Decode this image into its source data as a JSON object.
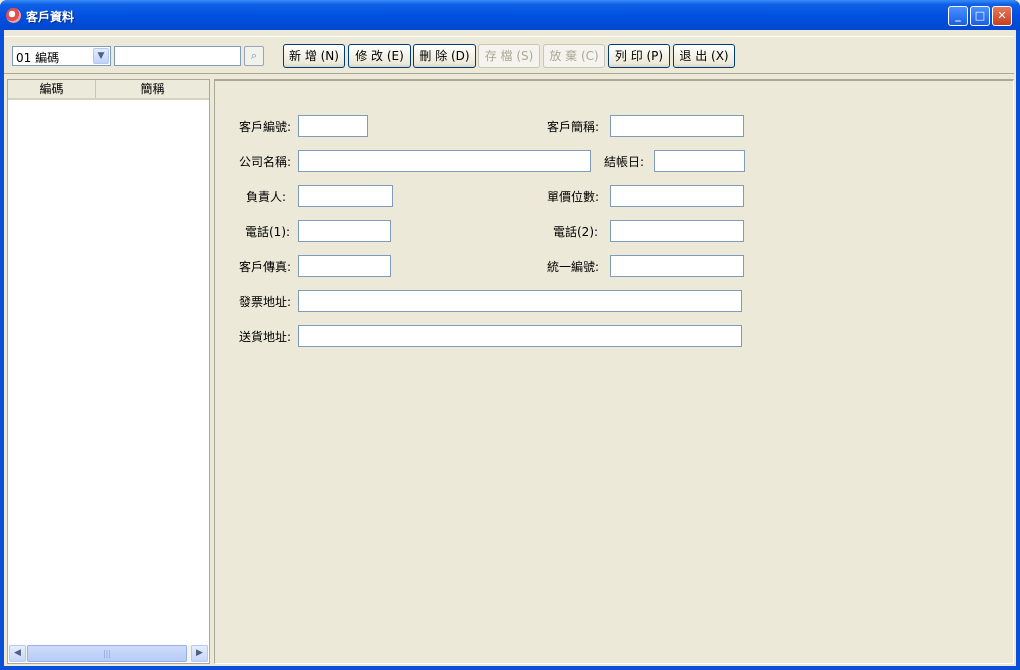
{
  "window": {
    "title": "客戶資料",
    "controls": {
      "minimize": "_",
      "maximize": "□",
      "close": "✕"
    }
  },
  "toolbar": {
    "field_select": {
      "selected": "01 編碼"
    },
    "search": {
      "value": ""
    },
    "buttons": {
      "add": "新 增 (N)",
      "edit": "修 改 (E)",
      "delete": "刪 除 (D)",
      "save": "存 檔 (S)",
      "discard": "放 棄 (C)",
      "print": "列 印 (P)",
      "exit": "退 出 (X)"
    }
  },
  "list": {
    "columns": [
      "編碼",
      "簡稱"
    ],
    "rows": []
  },
  "form": {
    "customer_no": {
      "label": "客戶編號:",
      "value": ""
    },
    "short_name": {
      "label": "客戶簡稱:",
      "value": ""
    },
    "company_name": {
      "label": "公司名稱:",
      "value": ""
    },
    "closing_day": {
      "label": "結帳日:",
      "value": ""
    },
    "manager": {
      "label": "負責人:",
      "value": ""
    },
    "price_digits": {
      "label": "單價位數:",
      "value": ""
    },
    "phone1": {
      "label": "電話(1):",
      "value": ""
    },
    "phone2": {
      "label": "電話(2):",
      "value": ""
    },
    "fax": {
      "label": "客戶傳真:",
      "value": ""
    },
    "tax_id": {
      "label": "統一編號:",
      "value": ""
    },
    "invoice_address": {
      "label": "發票地址:",
      "value": ""
    },
    "delivery_address": {
      "label": "送貨地址:",
      "value": ""
    }
  },
  "icons": {
    "app": "app-icon",
    "combo_arrow": "chevron-down-icon",
    "search_button": "search-icon",
    "scroll_left": "chevron-left-icon",
    "scroll_right": "chevron-right-icon"
  }
}
